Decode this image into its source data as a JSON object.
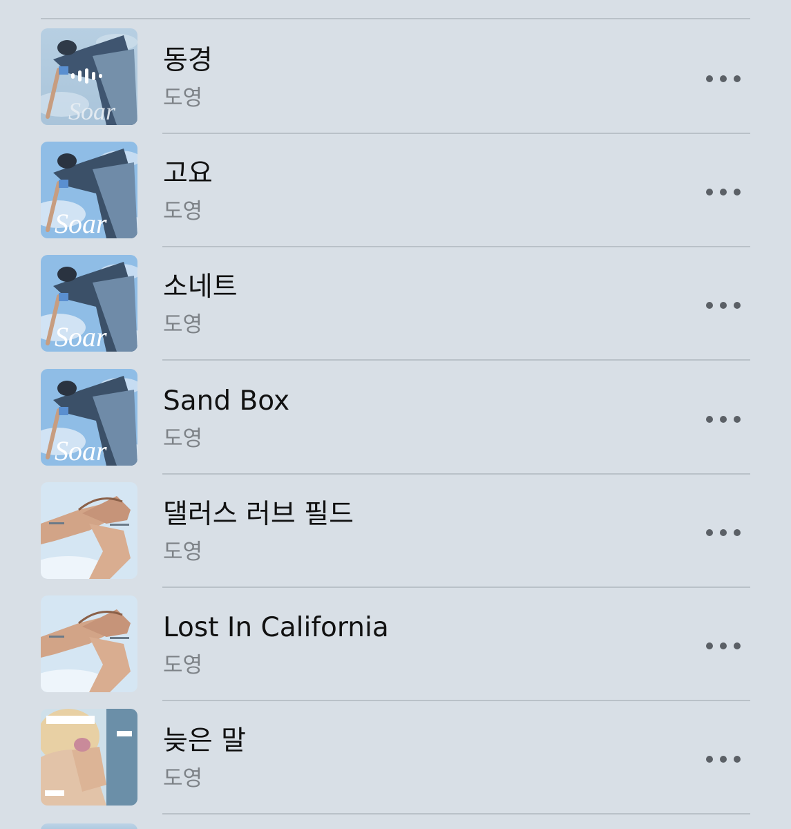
{
  "songs": [
    {
      "title": "동경",
      "artist": "도영",
      "artwork": "soar",
      "now_playing": true
    },
    {
      "title": "고요",
      "artist": "도영",
      "artwork": "soar",
      "now_playing": false
    },
    {
      "title": "소네트",
      "artist": "도영",
      "artwork": "soar",
      "now_playing": false
    },
    {
      "title": "Sand Box",
      "artist": "도영",
      "artwork": "soar",
      "now_playing": false
    },
    {
      "title": "댈러스 러브 필드",
      "artist": "도영",
      "artwork": "hands",
      "now_playing": false
    },
    {
      "title": "Lost In California",
      "artist": "도영",
      "artwork": "hands",
      "now_playing": false
    },
    {
      "title": "늦은 말",
      "artist": "도영",
      "artwork": "portrait",
      "now_playing": false
    }
  ],
  "artwork_text": {
    "soar": "Soar"
  },
  "icons": {
    "more": "ellipsis-icon",
    "playing": "now-playing-icon"
  },
  "colors": {
    "background": "#d8dfe6",
    "title": "#111111",
    "artist": "#7d8287",
    "divider": "#b9c1c8"
  }
}
